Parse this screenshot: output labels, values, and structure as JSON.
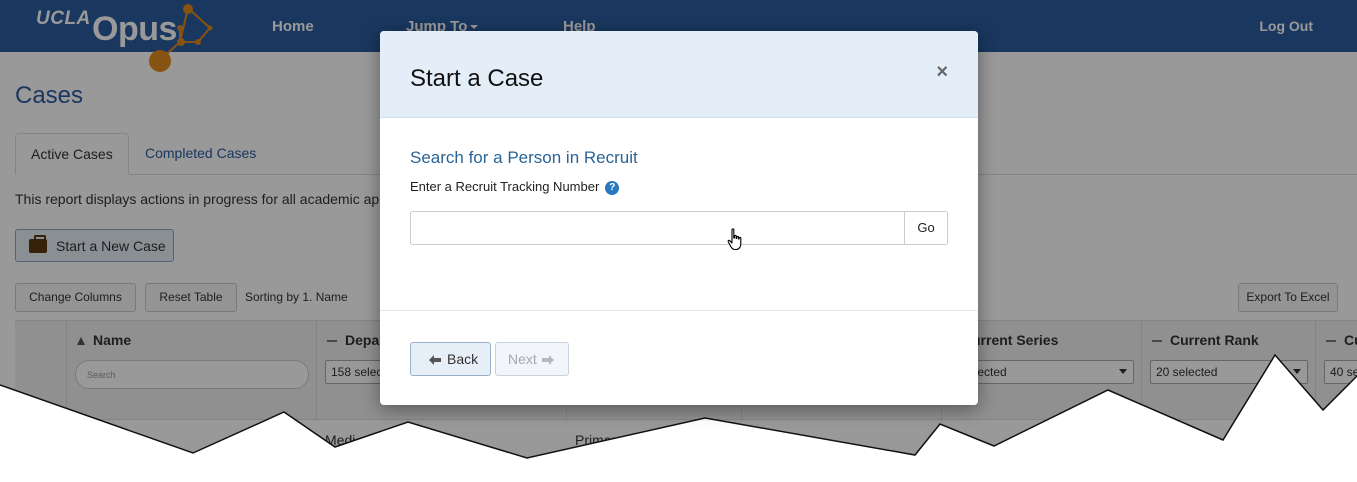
{
  "navbar": {
    "logo_small": "UCLA",
    "logo_large": "Opus",
    "home": "Home",
    "jump_to": "Jump To",
    "help": "Help",
    "log_out": "Log Out"
  },
  "page": {
    "title": "Cases",
    "tabs": [
      {
        "label": "Active Cases",
        "active": true
      },
      {
        "label": "Completed Cases",
        "active": false
      }
    ],
    "description": "This report displays actions in progress for all academic app",
    "start_new_case": "Start a New Case",
    "change_columns": "Change Columns",
    "reset_table": "Reset Table",
    "sorting": "Sorting by 1. Name",
    "export": "Export To Excel"
  },
  "table": {
    "columns": [
      {
        "title": "Name",
        "search_placeholder": "Search"
      },
      {
        "title": "Depar",
        "filter": "158 selec"
      },
      {
        "title": "urrent Series",
        "filter": "elected"
      },
      {
        "title": "Current Rank",
        "filter": "20 selected"
      },
      {
        "title": "Cu",
        "filter": "40 se"
      }
    ],
    "row_fragments": [
      "Medi",
      "Primar"
    ]
  },
  "modal": {
    "title": "Start a Case",
    "close": "×",
    "heading": "Search for a Person in Recruit",
    "field_label": "Enter a Recruit Tracking Number",
    "help": "?",
    "input_value": "",
    "go": "Go",
    "back": "Back",
    "next": "Next"
  },
  "colors": {
    "navbar": "#2a5c9e",
    "logo_accent": "#e08a1e",
    "link": "#2a6496",
    "modal_header": "#e3eef8"
  },
  "icons": [
    "briefcase-icon",
    "help-icon",
    "close-icon",
    "arrow-left-icon",
    "arrow-right-icon",
    "hand-cursor-icon",
    "sort-up-icon",
    "caret-down-icon"
  ]
}
